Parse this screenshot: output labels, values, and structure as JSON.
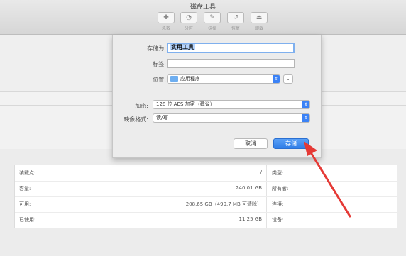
{
  "window": {
    "title": "磁盘工具"
  },
  "toolbar": {
    "buttons": [
      {
        "icon": "first-aid-icon",
        "glyph": "✚",
        "label": "急救"
      },
      {
        "icon": "partition-icon",
        "glyph": "◔",
        "label": "分区"
      },
      {
        "icon": "erase-icon",
        "glyph": "✎",
        "label": "抹掉"
      },
      {
        "icon": "restore-icon",
        "glyph": "↺",
        "label": "恢复"
      },
      {
        "icon": "unmount-icon",
        "glyph": "⏏",
        "label": "卸载"
      }
    ]
  },
  "dialog": {
    "save_as_label": "存储为:",
    "save_as_value": "实用工具",
    "tags_label": "标签:",
    "tags_value": "",
    "location_label": "位置:",
    "location_value": "应用程序",
    "encryption_label": "加密:",
    "encryption_value": "128 位 AES 加密（建议）",
    "format_label": "映像格式:",
    "format_value": "读/写",
    "cancel_label": "取消",
    "save_label": "存储"
  },
  "info": {
    "rows": [
      {
        "label": "装载点:",
        "value": "/",
        "right_label": "类型:"
      },
      {
        "label": "容量:",
        "value": "240.01 GB",
        "right_label": "所有者:"
      },
      {
        "label": "可用:",
        "value": "208.65 GB（499.7 MB 可清除）",
        "right_label": "连接:"
      },
      {
        "label": "已使用:",
        "value": "11.25 GB",
        "right_label": "设备:"
      }
    ]
  },
  "colors": {
    "accent": "#3b82f6",
    "annotation": "#e53935"
  }
}
